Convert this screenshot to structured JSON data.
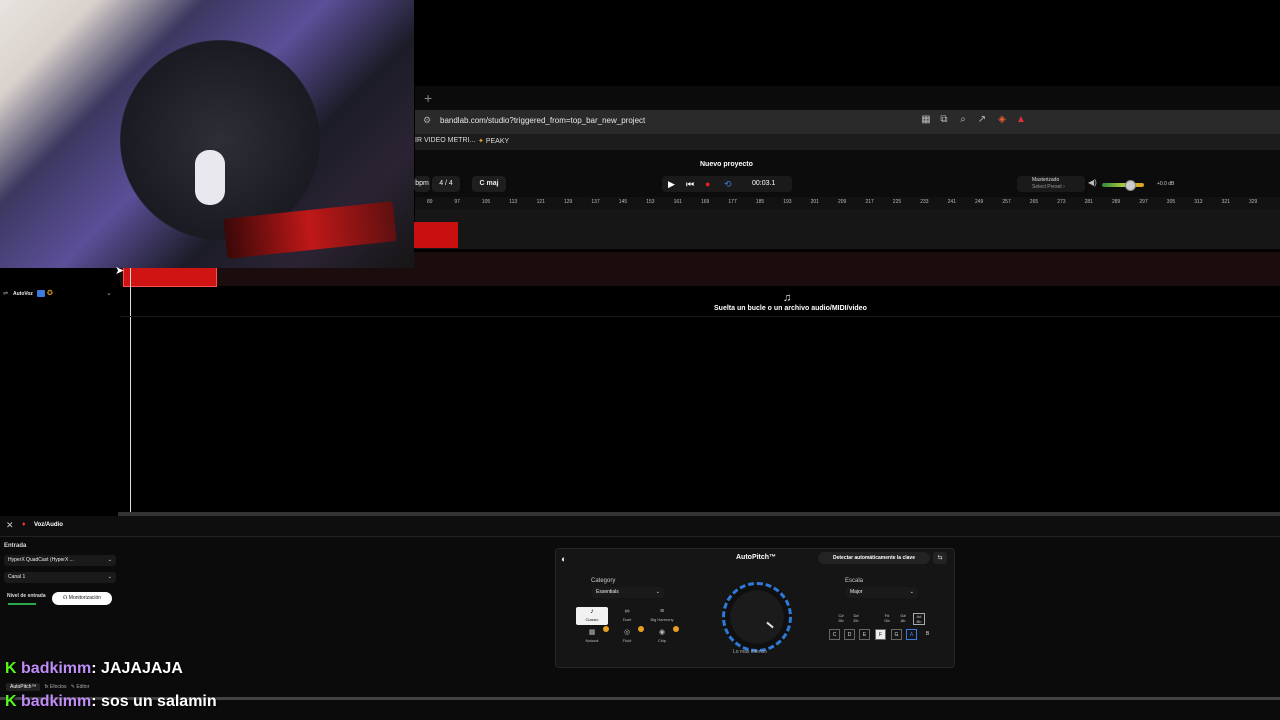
{
  "browser": {
    "new_tab": "+",
    "url": "bandlab.com/studio?triggered_from=top_bar_new_project",
    "bookmarks": [
      "IR VIDEO METRI...",
      "PEAKY"
    ]
  },
  "header": {
    "project_title": "Nuevo proyecto",
    "bpm": "bpm",
    "time_signature": "4 / 4",
    "key": "C maj",
    "time": "00:03.1",
    "preset_label": "Masterizado",
    "preset_sub": "Select Preset ›",
    "volume_db": "+0.0 dB",
    "volume_level": 0.55
  },
  "ruler": [
    "89",
    "97",
    "105",
    "113",
    "121",
    "129",
    "137",
    "145",
    "153",
    "161",
    "169",
    "177",
    "185",
    "193",
    "201",
    "209",
    "217",
    "225",
    "233",
    "241",
    "249",
    "257",
    "265",
    "273",
    "281",
    "289",
    "297",
    "305",
    "313",
    "321",
    "329"
  ],
  "track": {
    "name": "AutoVoz"
  },
  "drop_zone": {
    "text": "Suelta un bucle o un archivo audio/MIDI/video"
  },
  "bottom": {
    "panel_title": "Voz/Audio",
    "entrada": "Entrada",
    "device": "HyperX QuadCast (HyperX ...",
    "canal": "Canal 1",
    "nivel": "Nivel de entrada",
    "monitor": "Monitorización"
  },
  "autopitch": {
    "title": "AutoPitch™",
    "detect": "Detectar automáticamente la clave",
    "category_label": "Category",
    "category": "Essentials",
    "presets": [
      "Classic",
      "Duet",
      "Big Harmony",
      "Natural",
      "Fluid",
      "Chip"
    ],
    "dial_label": "Lo más intenso",
    "scale_label": "Escala",
    "scale": "Major",
    "sharps": [
      "C#\nDb",
      "D#\nEb",
      "F#\nGb",
      "G#\nAb",
      "A#\nBb"
    ],
    "naturals": [
      "C",
      "D",
      "E",
      "F",
      "G",
      "A",
      "B"
    ]
  },
  "chat": [
    {
      "user": "badkimm",
      "msg": ": JAJAJAJA"
    },
    {
      "user": "badkimm",
      "msg": ": sos un salamin"
    }
  ],
  "tabs": [
    "AutoPitch™",
    "Efectos",
    "Editor"
  ]
}
